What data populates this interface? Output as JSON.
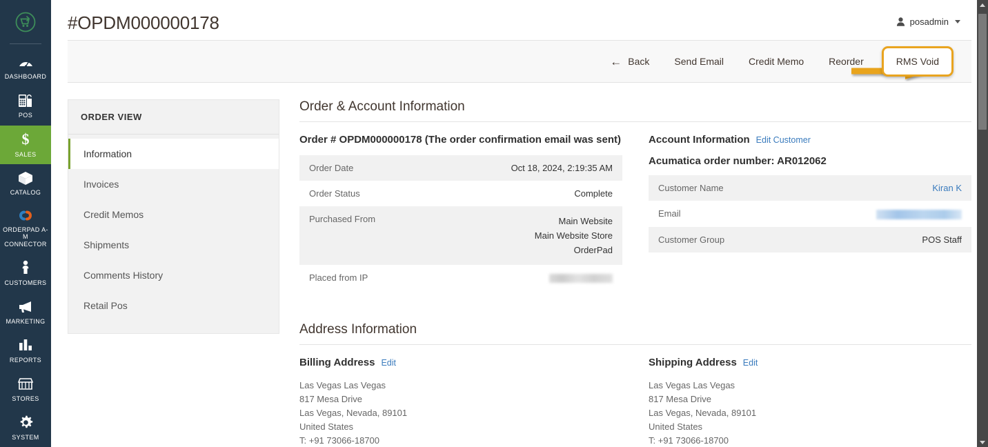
{
  "sidebar": {
    "logo_name": "magento-orderpad-logo",
    "items": [
      {
        "label": "DASHBOARD",
        "icon": "dashboard-gauge-icon",
        "active": false
      },
      {
        "label": "POS",
        "icon": "pos-terminal-icon",
        "active": false
      },
      {
        "label": "SALES",
        "icon": "dollar-sign-icon",
        "active": true
      },
      {
        "label": "CATALOG",
        "icon": "box-icon",
        "active": false
      },
      {
        "label": "ORDERPAD A-M CONNECTOR",
        "icon": "chain-link-icon",
        "active": false
      },
      {
        "label": "CUSTOMERS",
        "icon": "person-icon",
        "active": false
      },
      {
        "label": "MARKETING",
        "icon": "megaphone-icon",
        "active": false
      },
      {
        "label": "REPORTS",
        "icon": "bar-chart-icon",
        "active": false
      },
      {
        "label": "STORES",
        "icon": "storefront-icon",
        "active": false
      },
      {
        "label": "SYSTEM",
        "icon": "gear-icon",
        "active": false
      }
    ]
  },
  "header": {
    "title": "#OPDM000000178",
    "user": "posadmin"
  },
  "toolbar": {
    "back": "Back",
    "back_icon": "arrow-left-icon",
    "send_email": "Send Email",
    "credit_memo": "Credit Memo",
    "reorder": "Reorder",
    "rms_void": "RMS Void",
    "highlight_color": "#e9a41f",
    "annotation_icon": "orange-arrow-annotation"
  },
  "order_view": {
    "heading": "ORDER VIEW",
    "items": [
      {
        "label": "Information",
        "active": true
      },
      {
        "label": "Invoices",
        "active": false
      },
      {
        "label": "Credit Memos",
        "active": false
      },
      {
        "label": "Shipments",
        "active": false
      },
      {
        "label": "Comments History",
        "active": false
      },
      {
        "label": "Retail Pos",
        "active": false
      }
    ]
  },
  "order_account": {
    "section_title": "Order & Account Information",
    "order_heading": "Order # OPDM000000178 (The order confirmation email was sent)",
    "rows": [
      {
        "key": "Order Date",
        "value": "Oct 18, 2024, 2:19:35 AM"
      },
      {
        "key": "Order Status",
        "value": "Complete"
      },
      {
        "key": "Purchased From",
        "value": "Main Website\nMain Website Store\nOrderPad"
      },
      {
        "key": "Placed from IP",
        "value": ""
      }
    ],
    "account_heading": "Account Information",
    "edit_customer_link": "Edit Customer",
    "acumatica_line": "Acumatica order number: AR012062",
    "account_rows": [
      {
        "key": "Customer Name",
        "value": "Kiran K"
      },
      {
        "key": "Email",
        "value": ""
      },
      {
        "key": "Customer Group",
        "value": "POS Staff"
      }
    ]
  },
  "address": {
    "section_title": "Address Information",
    "billing_title": "Billing Address",
    "billing_edit": "Edit",
    "billing_lines": "Las Vegas Las Vegas\n817 Mesa Drive\nLas Vegas, Nevada, 89101\nUnited States\nT: +91 73066-18700",
    "shipping_title": "Shipping Address",
    "shipping_edit": "Edit",
    "shipping_lines": "Las Vegas Las Vegas\n817 Mesa Drive\nLas Vegas, Nevada, 89101\nUnited States\nT: +91 73066-18700"
  }
}
